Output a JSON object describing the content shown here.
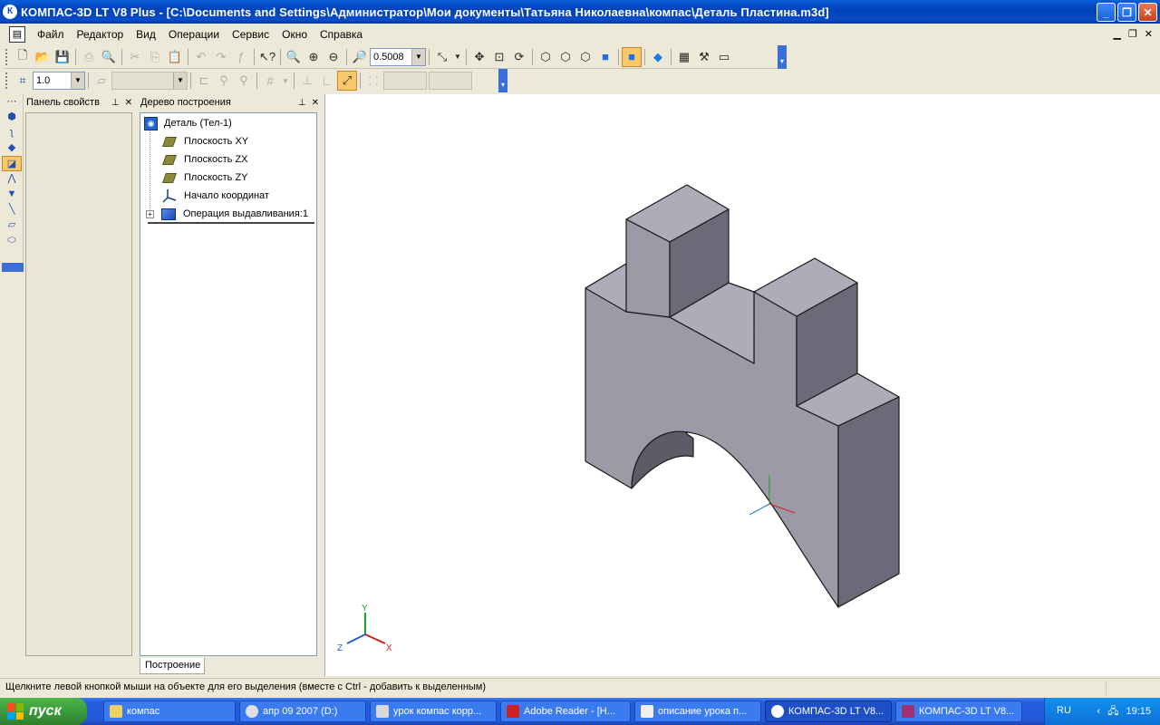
{
  "window": {
    "title": "КОМПАС-3D LT V8 Plus - [C:\\Documents and Settings\\Администратор\\Мои документы\\Татьяна Николаевна\\компас\\Деталь Пластина.m3d]",
    "app_icon": "К",
    "controls": [
      "minimize-icon",
      "restore-icon",
      "close-icon"
    ]
  },
  "menu": {
    "items": [
      "Файл",
      "Редактор",
      "Вид",
      "Операции",
      "Сервис",
      "Окно",
      "Справка"
    ]
  },
  "toolbar": {
    "zoom_value": "0.5008",
    "step_value": "1.0"
  },
  "properties_panel": {
    "title": "Панель свойств"
  },
  "tree_panel": {
    "title": "Дерево построения",
    "root": "Деталь (Тел-1)",
    "items": [
      "Плоскость XY",
      "Плоскость ZX",
      "Плоскость ZY",
      "Начало координат",
      "Операция выдавливания:1"
    ],
    "tab": "Построение"
  },
  "viewport": {
    "axes": {
      "x": "X",
      "y": "Y",
      "z": "Z"
    },
    "colors": {
      "face_front": "#9b9aa6",
      "face_top": "#adacb8",
      "face_side": "#6b6a78",
      "edge": "#1a1a1a"
    }
  },
  "status_bar": {
    "message": "Щелкните левой кнопкой мыши на объекте для его выделения (вместе с Ctrl - добавить к выделенным)"
  },
  "taskbar": {
    "start_label": "пуск",
    "tasks": [
      "компас",
      "апр 09 2007 (D:)",
      "урок компас корр...",
      "Adobe Reader - [Н...",
      "описание урока п...",
      "КОМПАС-3D LT V8...",
      "КОМПАС-3D LT V8..."
    ],
    "language": "RU",
    "clock": "19:15"
  }
}
